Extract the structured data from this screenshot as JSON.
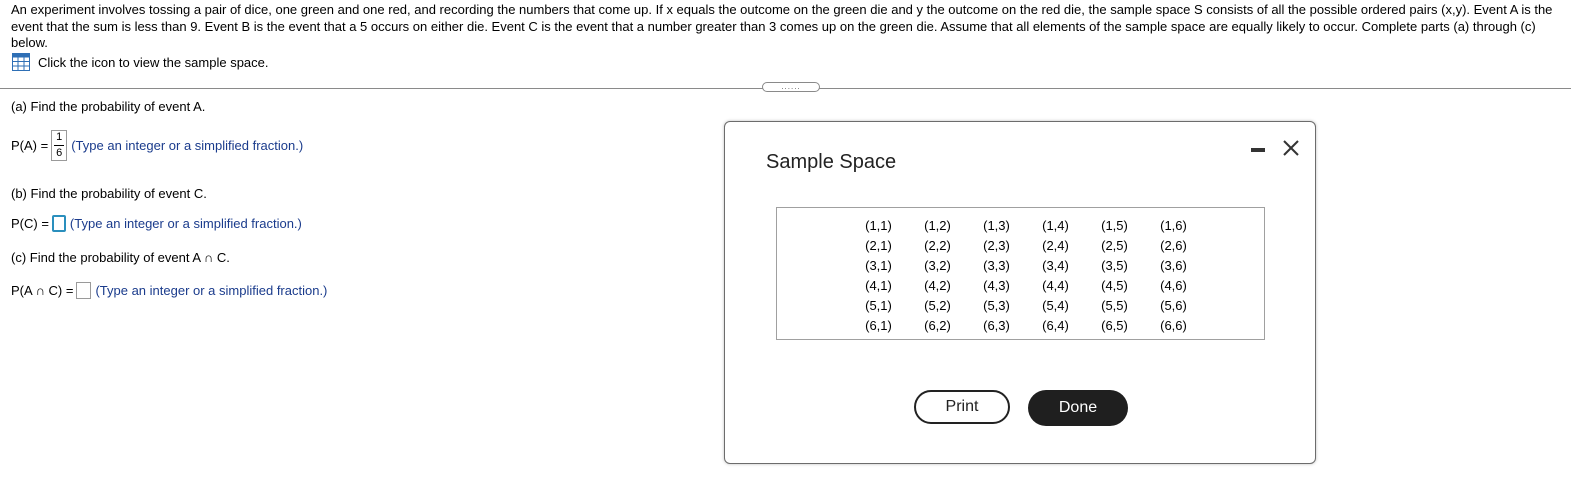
{
  "problem_text": "An experiment involves tossing a pair of dice, one green and one red, and recording the numbers that come up. If x equals the outcome on the green die and y the outcome on the red die, the sample space S consists of all the possible ordered pairs (x,y). Event A is the event that the sum is less than 9. Event B is the event that a 5 occurs on either die. Event C is the event that a number greater than 3 comes up on the green die. Assume that all elements of the sample space are equally likely to occur. Complete parts (a) through (c) below.",
  "sample_link": {
    "label": "Click the icon to view the sample space.",
    "icon": "table-grid-icon"
  },
  "drag_handle": "......",
  "parts": {
    "a": {
      "question": "(a) Find the probability of event A.",
      "prefix": "P(A) =",
      "answer_numerator": "1",
      "answer_denominator": "6",
      "hint": "(Type an integer or a simplified fraction.)"
    },
    "b": {
      "question": "(b) Find the probability of event C.",
      "prefix": "P(C) =",
      "answer": "",
      "hint": "(Type an integer or a simplified fraction.)"
    },
    "c": {
      "question": "(c) Find the probability of event A ∩ C.",
      "prefix": "P(A ∩ C) =",
      "answer": "",
      "hint": "(Type an integer or a simplified fraction.)"
    }
  },
  "dialog": {
    "title": "Sample Space",
    "print_label": "Print",
    "done_label": "Done",
    "minimize_icon": "minimize-icon",
    "close_icon": "close-icon",
    "rows": [
      [
        "(1,1)",
        "(1,2)",
        "(1,3)",
        "(1,4)",
        "(1,5)",
        "(1,6)"
      ],
      [
        "(2,1)",
        "(2,2)",
        "(2,3)",
        "(2,4)",
        "(2,5)",
        "(2,6)"
      ],
      [
        "(3,1)",
        "(3,2)",
        "(3,3)",
        "(3,4)",
        "(3,5)",
        "(3,6)"
      ],
      [
        "(4,1)",
        "(4,2)",
        "(4,3)",
        "(4,4)",
        "(4,5)",
        "(4,6)"
      ],
      [
        "(5,1)",
        "(5,2)",
        "(5,3)",
        "(5,4)",
        "(5,5)",
        "(5,6)"
      ],
      [
        "(6,1)",
        "(6,2)",
        "(6,3)",
        "(6,4)",
        "(6,5)",
        "(6,6)"
      ]
    ]
  },
  "colors": {
    "hint": "#1a3b8c",
    "active_input_border": "#2a8fbd",
    "icon_blue": "#2e6fb5",
    "done_bg": "#1f1f1f"
  }
}
